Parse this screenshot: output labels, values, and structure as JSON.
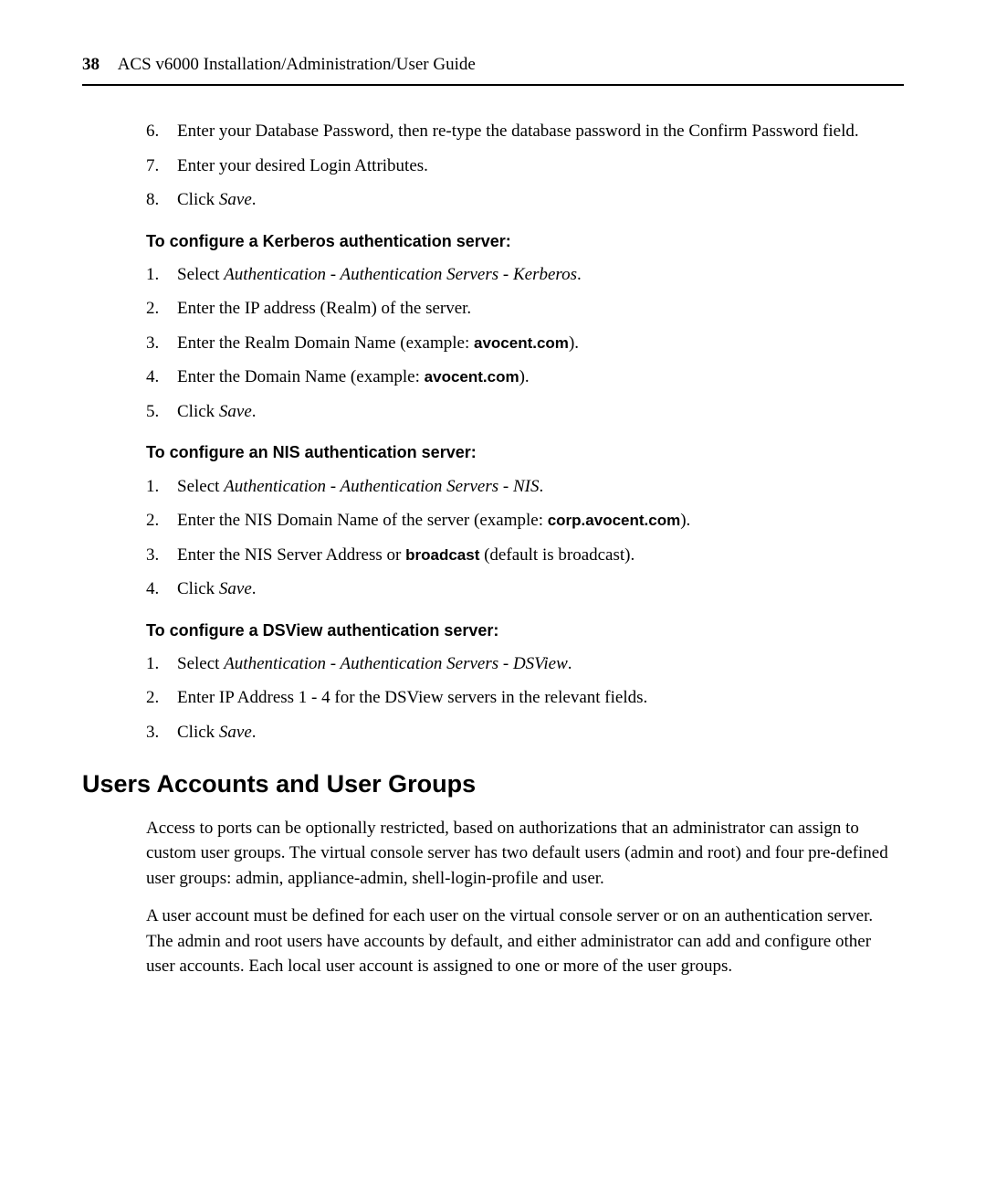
{
  "pageNumber": "38",
  "runningHeader": "ACS v6000 Installation/Administration/User Guide",
  "listA": [
    {
      "n": "6.",
      "t": "Enter your Database Password, then re-type the database password in the Confirm Password field."
    },
    {
      "n": "7.",
      "t": "Enter your desired Login Attributes."
    },
    {
      "n": "8.",
      "ta": "Click ",
      "em": "Save",
      "tb": "."
    }
  ],
  "headingKerberos": "To configure a Kerberos authentication server:",
  "listKerberos": [
    {
      "n": "1.",
      "ta": "Select ",
      "em": "Authentication - Authentication Servers - Kerberos",
      "tb": "."
    },
    {
      "n": "2.",
      "t": "Enter the IP address (Realm) of the server."
    },
    {
      "n": "3.",
      "ta": "Enter the Realm Domain Name (example: ",
      "sb": "avocent.com",
      "tb": ")."
    },
    {
      "n": "4.",
      "ta": "Enter the Domain Name (example: ",
      "sb": "avocent.com",
      "tb": ")."
    },
    {
      "n": "5.",
      "ta": "Click ",
      "em": "Save",
      "tb": "."
    }
  ],
  "headingNIS": "To configure an NIS authentication server:",
  "listNIS": [
    {
      "n": "1.",
      "ta": "Select ",
      "em": "Authentication - Authentication Servers - NIS",
      "tb": "."
    },
    {
      "n": "2.",
      "ta": "Enter the NIS Domain Name of the server (example: ",
      "sb": "corp.avocent.com",
      "tb": ")."
    },
    {
      "n": "3.",
      "ta": "Enter the NIS Server Address or ",
      "sb": "broadcast",
      "tb": " (default is broadcast)."
    },
    {
      "n": "4.",
      "ta": "Click ",
      "em": "Save",
      "tb": "."
    }
  ],
  "headingDSView": "To configure a DSView authentication server:",
  "listDSView": [
    {
      "n": "1.",
      "ta": "Select ",
      "em": "Authentication - Authentication Servers - DSView",
      "tb": "."
    },
    {
      "n": "2.",
      "t": "Enter IP Address 1 - 4 for the DSView servers in the relevant fields."
    },
    {
      "n": "3.",
      "ta": "Click ",
      "em": "Save",
      "tb": "."
    }
  ],
  "h2": "Users Accounts and User Groups",
  "p1": "Access to ports can be optionally restricted, based on authorizations that an administrator can assign to custom user groups. The virtual console server has two default users (admin and root) and four pre-defined user groups: admin, appliance-admin, shell-login-profile and user.",
  "p2": "A user account must be defined for each user on the virtual console server or on an authentication server. The admin and root users have accounts by default, and either administrator can add and configure other user accounts. Each local user account is assigned to one or more of the user groups."
}
